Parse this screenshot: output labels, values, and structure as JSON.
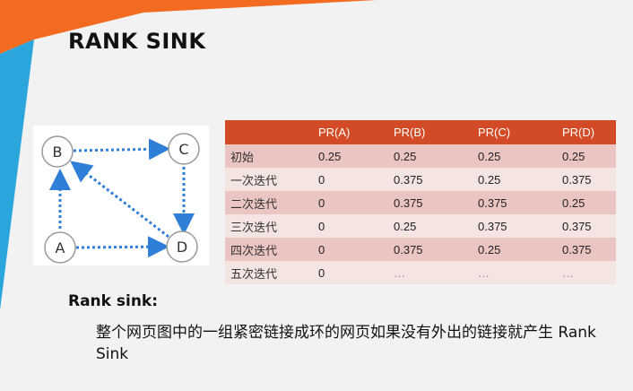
{
  "slide": {
    "title": "RANK SINK",
    "colors": {
      "accent_orange": "#f36b21",
      "accent_blue": "#2aa6dc",
      "table_header": "#d24b26",
      "arrow_blue": "#2f7fd8"
    }
  },
  "graph": {
    "nodes": [
      {
        "id": "A",
        "label": "A"
      },
      {
        "id": "B",
        "label": "B"
      },
      {
        "id": "C",
        "label": "C"
      },
      {
        "id": "D",
        "label": "D"
      }
    ],
    "edges": [
      {
        "from": "B",
        "to": "C"
      },
      {
        "from": "C",
        "to": "D"
      },
      {
        "from": "A",
        "to": "B"
      },
      {
        "from": "A",
        "to": "D"
      },
      {
        "from": "D",
        "to": "B"
      }
    ]
  },
  "table": {
    "headers": [
      "",
      "PR(A)",
      "PR(B)",
      "PR(C)",
      "PR(D)"
    ],
    "rows": [
      [
        "初始",
        "0.25",
        "0.25",
        "0.25",
        "0.25"
      ],
      [
        "一次迭代",
        "0",
        "0.375",
        "0.25",
        "0.375"
      ],
      [
        "二次迭代",
        "0",
        "0.375",
        "0.375",
        "0.25"
      ],
      [
        "三次迭代",
        "0",
        "0.25",
        "0.375",
        "0.375"
      ],
      [
        "四次迭代",
        "0",
        "0.375",
        "0.25",
        "0.375"
      ],
      [
        "五次迭代",
        "0",
        "…",
        "…",
        "…"
      ]
    ]
  },
  "rank_sink": {
    "heading": "Rank sink:",
    "description": "整个网页图中的一组紧密链接成环的网页如果没有外出的链接就产生 Rank Sink"
  }
}
